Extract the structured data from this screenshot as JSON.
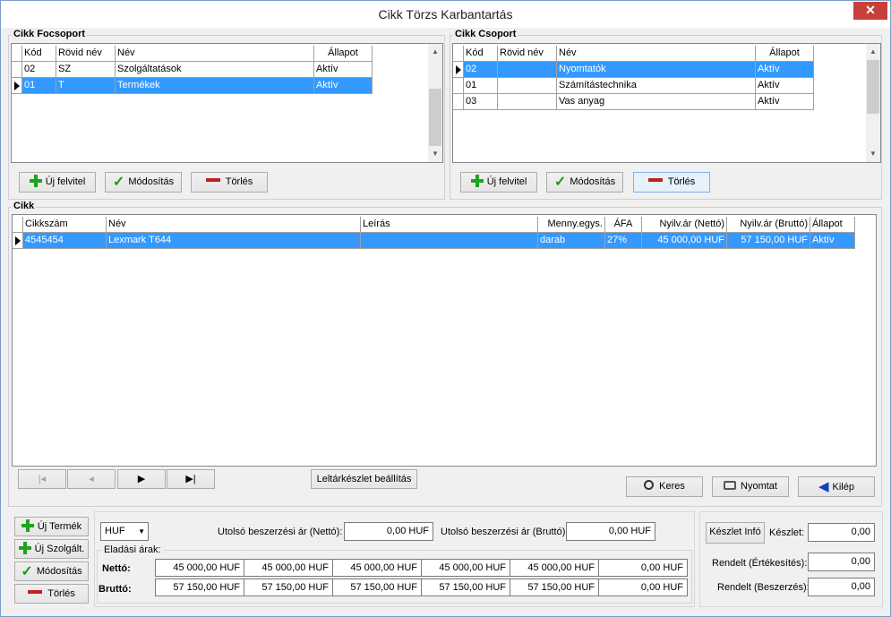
{
  "window": {
    "title": "Cikk Törzs Karbantartás",
    "close": "✕"
  },
  "focsoport": {
    "label": "Cikk Focsoport",
    "headers": [
      "Kód",
      "Rövid név",
      "Név",
      "Állapot"
    ],
    "rows": [
      [
        "02",
        "SZ",
        "Szolgáltatások",
        "Aktív"
      ],
      [
        "01",
        "T",
        "Termékek",
        "Aktív"
      ]
    ],
    "buttons": {
      "new": "Új felvitel",
      "edit": "Módosítás",
      "delete": "Törlés"
    }
  },
  "csoport": {
    "label": "Cikk Csoport",
    "headers": [
      "Kód",
      "Rövid név",
      "Név",
      "Állapot"
    ],
    "rows": [
      [
        "02",
        "",
        "Nyomtatók",
        "Aktív"
      ],
      [
        "01",
        "",
        "Számítástechnika",
        "Aktív"
      ],
      [
        "03",
        "",
        "Vas anyag",
        "Aktív"
      ]
    ],
    "buttons": {
      "new": "Új felvitel",
      "edit": "Módosítás",
      "delete": "Törlés"
    }
  },
  "cikk": {
    "label": "Cikk",
    "headers": [
      "Cikkszám",
      "Név",
      "Leírás",
      "Menny.egys.",
      "ÁFA",
      "Nyilv.ár (Nettó)",
      "Nyilv.ár (Bruttó)",
      "Állapot"
    ],
    "rows": [
      [
        "4545454",
        "Lexmark T644",
        "",
        "darab",
        "27%",
        "45 000,00 HUF",
        "57 150,00 HUF",
        "Aktív"
      ]
    ]
  },
  "nav": {
    "first": "|◂",
    "prev": "◂",
    "next": "▶",
    "last": "▶|",
    "leltar": "Leltárkészlet beállítás"
  },
  "actions": {
    "search": "Keres",
    "print": "Nyomtat",
    "exit": "Kilép"
  },
  "side": {
    "uj_termek": "Új Termék",
    "uj_szolg": "Új Szolgált.",
    "modositas": "Módosítás",
    "torles": "Törlés"
  },
  "prices": {
    "currency": "HUF",
    "last_net_label": "Utolsó beszerzési ár (Nettó):",
    "last_net": "0,00 HUF",
    "last_gross_label": "Utolsó beszerzési ár (Bruttó):",
    "last_gross": "0,00 HUF",
    "sales_label": "Eladási árak:",
    "net_label": "Nettó:",
    "gross_label": "Bruttó:",
    "net": [
      "45 000,00 HUF",
      "45 000,00 HUF",
      "45 000,00 HUF",
      "45 000,00 HUF",
      "45 000,00 HUF",
      "0,00 HUF"
    ],
    "gross": [
      "57 150,00 HUF",
      "57 150,00 HUF",
      "57 150,00 HUF",
      "57 150,00 HUF",
      "57 150,00 HUF",
      "0,00 HUF"
    ]
  },
  "stock": {
    "info_btn": "Készlet Infó",
    "keszlet_label": "Készlet:",
    "keszlet": "0,00",
    "rend_ert_label": "Rendelt (Értékesítés):",
    "rend_ert": "0,00",
    "rend_besz_label": "Rendelt (Beszerzés):",
    "rend_besz": "0,00"
  },
  "colors": {
    "selection": "#3399ff",
    "title_close": "#c7403a"
  }
}
